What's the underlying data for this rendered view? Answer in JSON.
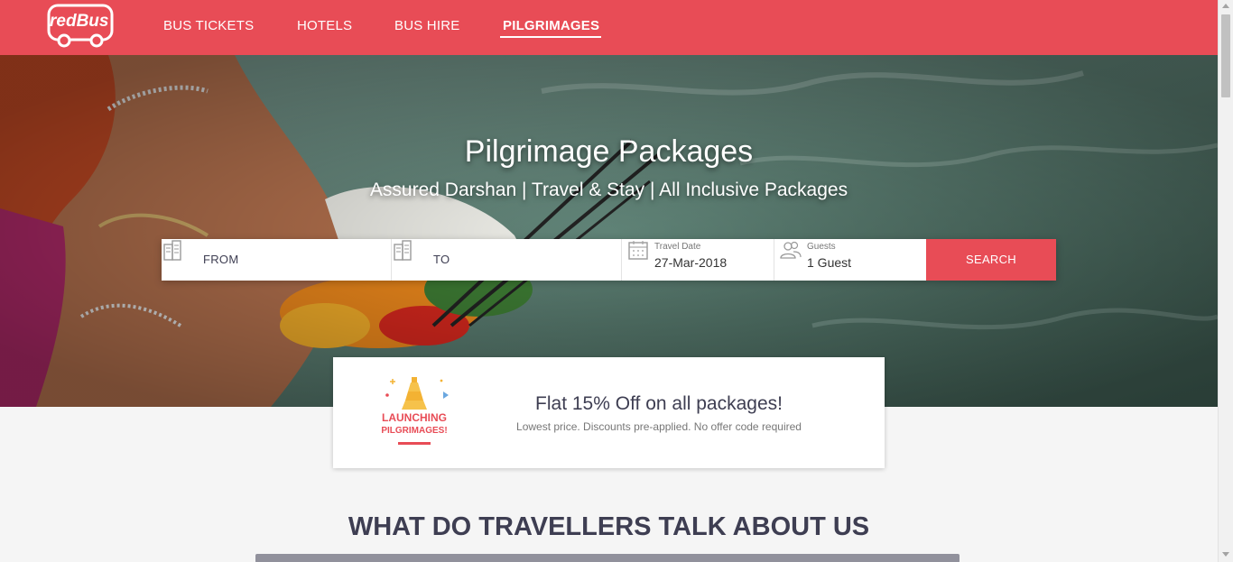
{
  "brand": {
    "logo_text": "redBus",
    "color": "#e84c56"
  },
  "nav": {
    "items": [
      {
        "label": "BUS TICKETS",
        "active": false
      },
      {
        "label": "HOTELS",
        "active": false
      },
      {
        "label": "BUS HIRE",
        "active": false
      },
      {
        "label": "PILGRIMAGES",
        "active": true
      }
    ]
  },
  "hero": {
    "title": "Pilgrimage Packages",
    "subtitle": "Assured Darshan | Travel & Stay | All Inclusive Packages"
  },
  "search": {
    "from_label": "FROM",
    "to_label": "TO",
    "date_caption": "Travel Date",
    "date_value": "27-Mar-2018",
    "guests_caption": "Guests",
    "guests_value": "1 Guest",
    "button_label": "SEARCH",
    "icons": {
      "from": "building-icon",
      "to": "building-icon",
      "date": "calendar-icon",
      "guests": "guests-icon"
    }
  },
  "offer": {
    "badge_line1": "LAUNCHING",
    "badge_line2": "PILGRIMAGES!",
    "title": "Flat 15% Off on all packages!",
    "subtitle": "Lowest price. Discounts pre-applied. No offer code required"
  },
  "testimonials": {
    "title": "WHAT DO TRAVELLERS TALK ABOUT US"
  }
}
